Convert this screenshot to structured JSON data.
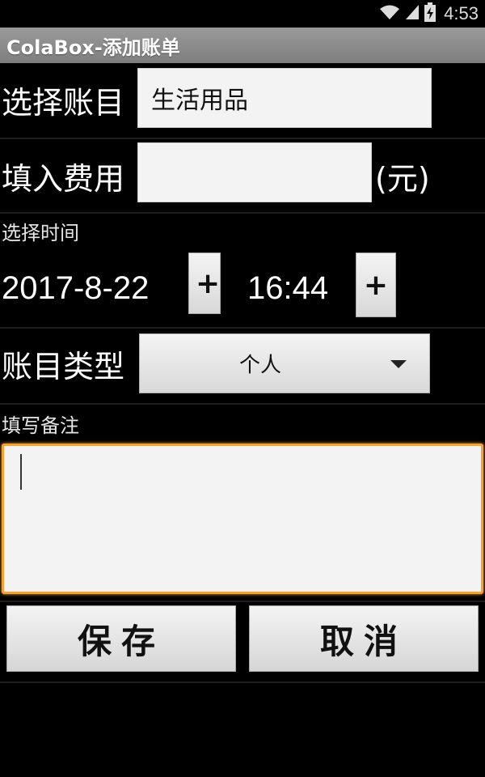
{
  "status_bar": {
    "time": "4:53",
    "icons": [
      "wifi-icon",
      "cell-signal-icon",
      "battery-charging-icon"
    ]
  },
  "title_bar": {
    "title": "ColaBox-添加账单"
  },
  "form": {
    "category_label": "选择账目",
    "category_value": "生活用品",
    "amount_label": "填入费用",
    "amount_value": "",
    "amount_unit": "(元)",
    "time_label": "选择时间",
    "date_value": "2017-8-22",
    "date_button": "+",
    "time_value": "16:44",
    "time_button": "+",
    "type_label": "账目类型",
    "type_value": "个人",
    "note_label": "填写备注",
    "note_value": ""
  },
  "actions": {
    "save_label": "保存",
    "cancel_label": "取消"
  },
  "colors": {
    "focus_border": "#f7a230",
    "title_bar": "#8a8a8a",
    "background": "#000000"
  }
}
